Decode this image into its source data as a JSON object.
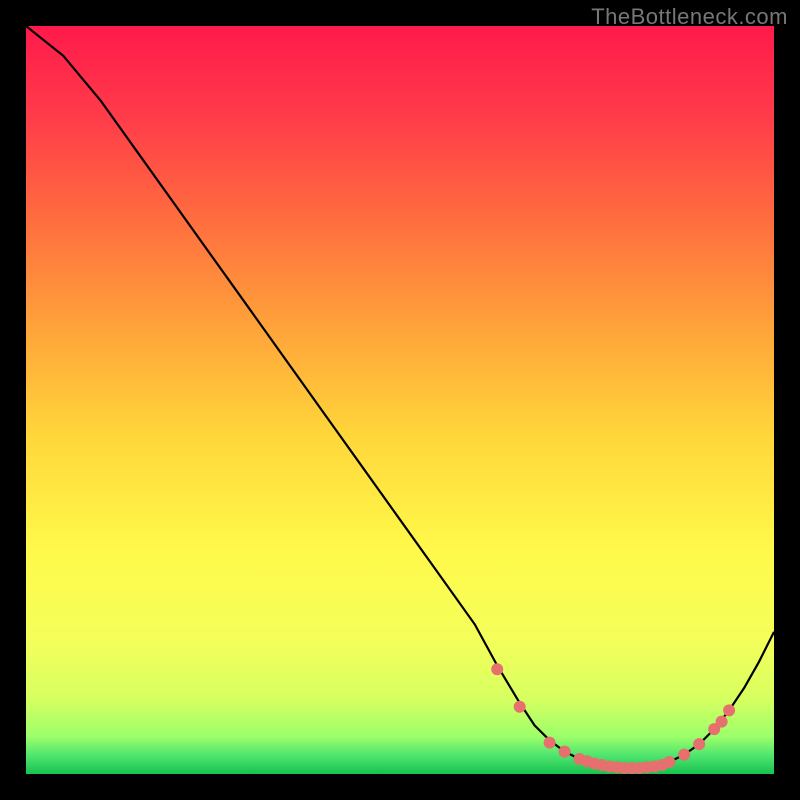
{
  "watermark": "TheBottleneck.com",
  "chart_data": {
    "type": "line",
    "title": "",
    "xlabel": "",
    "ylabel": "",
    "xlim": [
      0,
      100
    ],
    "ylim": [
      0,
      100
    ],
    "curve": {
      "name": "bottleneck-curve",
      "x": [
        0,
        5,
        10,
        15,
        20,
        25,
        30,
        35,
        40,
        45,
        50,
        55,
        60,
        63,
        66,
        68,
        70,
        72,
        74,
        76,
        78,
        80,
        82,
        84,
        86,
        88,
        90,
        92,
        94,
        96,
        98,
        100
      ],
      "y": [
        100,
        96,
        90,
        83,
        76,
        69,
        62,
        55,
        48,
        41,
        34,
        27,
        20,
        14.5,
        9.5,
        6.5,
        4.5,
        3.0,
        2.0,
        1.4,
        1.0,
        0.8,
        0.8,
        1.0,
        1.6,
        2.6,
        4.0,
        6.0,
        8.5,
        11.5,
        15,
        19
      ]
    },
    "markers": {
      "name": "highlight-points",
      "x": [
        63,
        66,
        70,
        72,
        74,
        75,
        76,
        77,
        78,
        79,
        80,
        81,
        82,
        83,
        84,
        85,
        86,
        88,
        90,
        92,
        93,
        94
      ],
      "y": [
        14.0,
        9.0,
        4.2,
        3.0,
        2.0,
        1.7,
        1.4,
        1.2,
        1.0,
        0.9,
        0.8,
        0.8,
        0.8,
        0.9,
        1.0,
        1.2,
        1.6,
        2.6,
        4.0,
        6.0,
        7.0,
        8.5
      ],
      "color": "#e6706e",
      "radius": 6
    },
    "gradient_stops": [
      {
        "offset": 0.0,
        "color": "#ff1a4b"
      },
      {
        "offset": 0.12,
        "color": "#ff3b4a"
      },
      {
        "offset": 0.25,
        "color": "#ff6a3f"
      },
      {
        "offset": 0.4,
        "color": "#ffa23a"
      },
      {
        "offset": 0.55,
        "color": "#ffd73a"
      },
      {
        "offset": 0.7,
        "color": "#fff94a"
      },
      {
        "offset": 0.82,
        "color": "#f4ff5a"
      },
      {
        "offset": 0.9,
        "color": "#d6ff60"
      },
      {
        "offset": 0.95,
        "color": "#9cff6a"
      },
      {
        "offset": 0.975,
        "color": "#4fe56e"
      },
      {
        "offset": 1.0,
        "color": "#17c24f"
      }
    ]
  }
}
